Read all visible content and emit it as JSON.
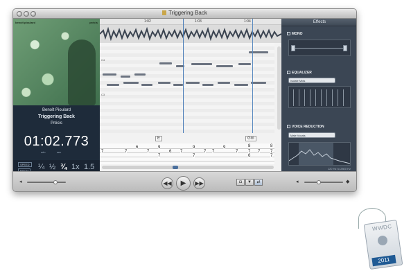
{
  "window": {
    "title": "Triggering Back"
  },
  "album": {
    "artist_tiny": "benoit pioulard",
    "album_tiny": "précis"
  },
  "track": {
    "artist": "Benoît Pioulard",
    "title": "Triggering Back",
    "album": "Précis"
  },
  "clock": {
    "time": "01:02.773",
    "min_label": "min",
    "sec_label": "sec"
  },
  "speed": {
    "speed_label": "SPEED",
    "pitch_label": "PITCH",
    "options": [
      "¼",
      "½",
      "¾",
      "1x",
      "1.5"
    ],
    "selected": "¾"
  },
  "timeline": {
    "markers": [
      "1:02",
      "1:03",
      "1:04"
    ]
  },
  "piano_roll": {
    "row_labels": [
      "C4",
      "C3"
    ]
  },
  "chords": [
    "E",
    "Gm"
  ],
  "tab_numbers": {
    "line1": [
      "6",
      "9",
      "9",
      "9",
      "8",
      "8"
    ],
    "line2": [
      "7",
      "7",
      "7",
      "6",
      "7",
      "7",
      "7",
      "7",
      "7",
      "7",
      "7"
    ],
    "line3": [
      "7",
      "7",
      "6",
      "7"
    ]
  },
  "effects": {
    "header": "Effects",
    "mono": "MONO",
    "equalizer": "EQUALIZER",
    "eq_preset": "Isolate Mids",
    "voice_reduction": "VOICE REDUCTION",
    "voice_preset": "Male Vocals",
    "freq_range": "120 Hz to 2800 Hz"
  },
  "badge": {
    "label": "WWDC",
    "year": "2011"
  },
  "colors": {
    "accent": "#4a7db8",
    "effects_bg": "#3b4654",
    "badge_blue": "#1f5a94"
  }
}
